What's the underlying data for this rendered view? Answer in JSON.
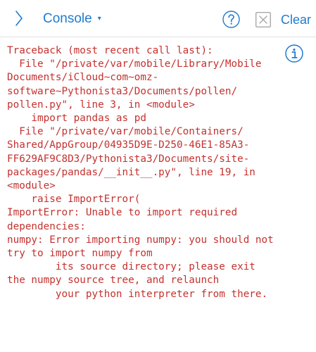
{
  "toolbar": {
    "back_icon": "chevron-right-icon",
    "title": "Console",
    "title_caret": "▾",
    "help_icon": "question-circle-icon",
    "clear_icon": "close-box-icon",
    "clear_label": "Clear",
    "accent_color": "#1f7bd0"
  },
  "console": {
    "text_color": "#c4322f",
    "info_icon": "info-circle-icon",
    "lines": [
      "Traceback (most recent call last):",
      "  File \"/private/var/mobile/Library/Mobile",
      "Documents/iCloud~com~omz-",
      "software~Pythonista3/Documents/pollen/",
      "pollen.py\", line 3, in <module>",
      "    import pandas as pd",
      "  File \"/private/var/mobile/Containers/",
      "Shared/AppGroup/04935D9E-D250-46E1-85A3-",
      "FF629AF9C8D3/Pythonista3/Documents/site-",
      "packages/pandas/__init__.py\", line 19, in",
      "<module>",
      "    raise ImportError(",
      "ImportError: Unable to import required",
      "dependencies:",
      "numpy: Error importing numpy: you should not",
      "try to import numpy from",
      "        its source directory; please exit",
      "the numpy source tree, and relaunch",
      "        your python interpreter from there."
    ]
  }
}
